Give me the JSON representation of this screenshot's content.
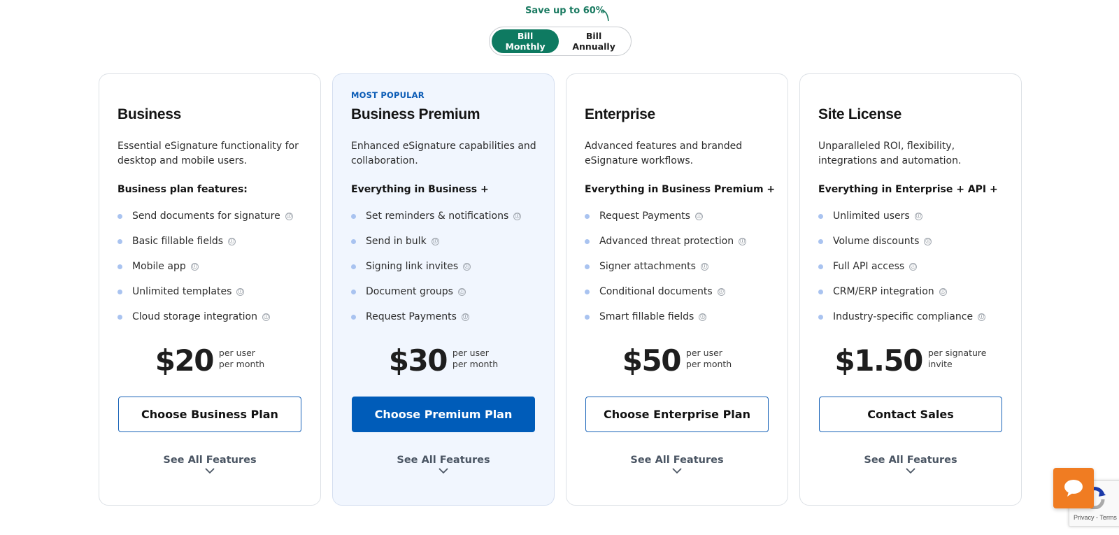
{
  "billing": {
    "save_note": "Save up to 60%",
    "options": [
      {
        "label": "Bill Monthly",
        "active": true
      },
      {
        "label": "Bill Annually",
        "active": false
      }
    ]
  },
  "colors": {
    "accent_green": "#0e7a61",
    "primary_blue": "#005cb9",
    "popular_bg": "#f1f6fe",
    "chat_orange": "#f07c22",
    "bullet": "#a9c3f0"
  },
  "plans": [
    {
      "name": "Business",
      "badge": "",
      "description": "Essential eSignature functionality for desktop and mobile users.",
      "features_heading": "Business plan features:",
      "features": [
        "Send documents for signature",
        "Basic fillable fields",
        "Mobile app",
        "Unlimited templates",
        "Cloud storage integration"
      ],
      "price": "$20",
      "unit_line1": "per user",
      "unit_line2": "per month",
      "cta": "Choose Business Plan",
      "see_all": "See All Features"
    },
    {
      "name": "Business Premium",
      "badge": "MOST POPULAR",
      "description": "Enhanced eSignature capabilities and collaboration.",
      "features_heading": "Everything in Business +",
      "features": [
        "Set reminders & notifications",
        "Send in bulk",
        "Signing link invites",
        "Document groups",
        "Request Payments"
      ],
      "price": "$30",
      "unit_line1": "per user",
      "unit_line2": "per month",
      "cta": "Choose Premium Plan",
      "see_all": "See All Features"
    },
    {
      "name": "Enterprise",
      "badge": "",
      "description": "Advanced features and branded eSignature workflows.",
      "features_heading": "Everything in Business Premium +",
      "features": [
        "Request Payments",
        "Advanced threat protection",
        "Signer attachments",
        "Conditional documents",
        "Smart fillable fields"
      ],
      "price": "$50",
      "unit_line1": "per user",
      "unit_line2": "per month",
      "cta": "Choose Enterprise Plan",
      "see_all": "See All Features"
    },
    {
      "name": "Site License",
      "badge": "",
      "description": "Unparalleled ROI, flexibility, integrations and automation.",
      "features_heading": "Everything in Enterprise + API +",
      "features": [
        "Unlimited users",
        "Volume discounts",
        "Full API access",
        "CRM/ERP integration",
        "Industry-specific compliance"
      ],
      "price": "$1.50",
      "unit_line1": "per signature",
      "unit_line2": "invite",
      "cta": "Contact Sales",
      "see_all": "See All Features"
    }
  ],
  "icons": {
    "info": "ⓘ",
    "chat": "chat-bubble-icon",
    "chevron": "chevron-down-icon"
  },
  "recaptcha": {
    "text": "Privacy - Terms"
  }
}
